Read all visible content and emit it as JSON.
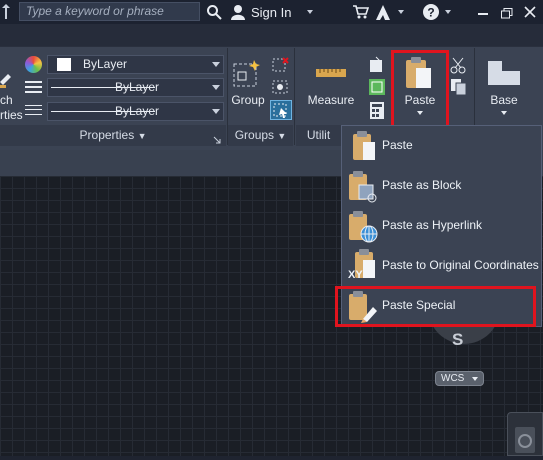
{
  "colors": {
    "highlight": "#e0141e",
    "ribbon": "#3b4353",
    "topbar": "#1c2230"
  },
  "topbar": {
    "search_placeholder": "Type a keyword or phrase",
    "sign_in_label": "Sign In",
    "search_icon": "search-icon",
    "user_icon": "user-icon",
    "cart_icon": "cart-icon",
    "app_icon": "autodesk-icon",
    "help_icon": "help-icon"
  },
  "ribbon": {
    "left_partial": {
      "line1": "ch",
      "line2": "rties"
    },
    "properties": {
      "color_value": "ByLayer",
      "linetype_value": "ByLayer",
      "lineweight_value": "ByLayer",
      "title": "Properties"
    },
    "groups": {
      "group_label": "Group",
      "title": "Groups"
    },
    "utilities": {
      "measure_label": "Measure",
      "title_partial": "Utilit"
    },
    "clipboard": {
      "paste_label": "Paste"
    },
    "view": {
      "base_label": "Base"
    }
  },
  "paste_menu": {
    "items": [
      {
        "label": "Paste",
        "icon": "paste-icon"
      },
      {
        "label": "Paste as Block",
        "icon": "paste-block-icon"
      },
      {
        "label": "Paste as Hyperlink",
        "icon": "paste-hyperlink-icon"
      },
      {
        "label": "Paste to Original Coordinates",
        "icon": "paste-coordinates-icon",
        "badge": "XY"
      },
      {
        "label": "Paste Special",
        "icon": "paste-special-icon"
      }
    ]
  },
  "viewcube": {
    "compass_label": "S",
    "wcs_label": "WCS"
  }
}
